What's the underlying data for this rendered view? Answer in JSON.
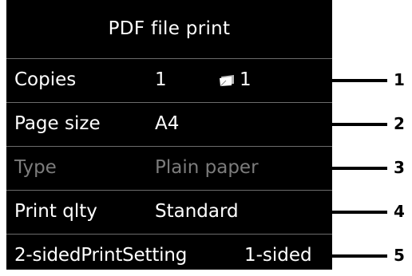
{
  "screen": {
    "title": "PDF file print",
    "rows": [
      {
        "label": "Copies",
        "value": "1",
        "page_count": "1"
      },
      {
        "label": "Page size",
        "value": "A4"
      },
      {
        "label": "Type",
        "value": "Plain paper",
        "disabled": true
      },
      {
        "label": "Print qlty",
        "value": "Standard"
      },
      {
        "label": "2-sidedPrintSetting",
        "value": "1-sided"
      }
    ]
  },
  "callouts": [
    "1",
    "2",
    "3",
    "4",
    "5"
  ],
  "icons": {
    "copies": "page-copies-icon"
  }
}
